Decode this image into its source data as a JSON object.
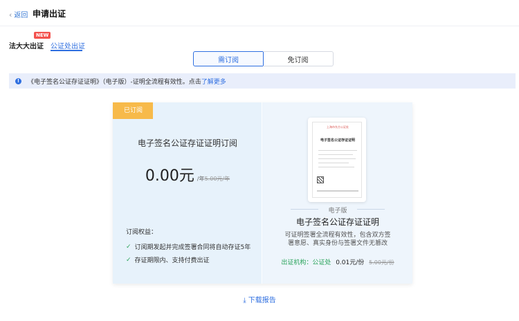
{
  "header": {
    "back_label": "返回",
    "title": "申请出证"
  },
  "tabs": [
    {
      "label": "法大大出证",
      "badge": "NEW"
    },
    {
      "label": "公证处出证"
    }
  ],
  "segments": {
    "subscribe": "需订阅",
    "free": "免订阅"
  },
  "notice": {
    "text": "《电子签名公证存证证明》（电子版）-证明全流程有效性。点击",
    "link": "了解更多"
  },
  "plan": {
    "badge": "已订阅",
    "title": "电子签名公证存证证明订阅",
    "price": "0.00元",
    "unit": "/年",
    "original_price": "5.00元/年",
    "benefits_title": "订阅权益：",
    "benefits": [
      "订阅期发起并完成签署合同将自动存证5年",
      "存证期限内、支持付费出证"
    ]
  },
  "certificate": {
    "edition": "电子版",
    "name": "电子签名公证存证证明",
    "description": "可证明签署全流程有效性，包含双方签署意愿、真实身份与签署文件无篡改",
    "issuer_label": "出证机构：公证处",
    "issuer_price": "0.01元/份",
    "issuer_original_price": "5.00元/份",
    "doc_header": "上海市东方公证处",
    "doc_title": "电子签名公证存证证明"
  },
  "download_label": "下载报告",
  "colors": {
    "accent": "#2f6fe0",
    "badge_orange": "#f7ba4a",
    "check_green": "#29a35a",
    "new_red": "#f3524e"
  }
}
